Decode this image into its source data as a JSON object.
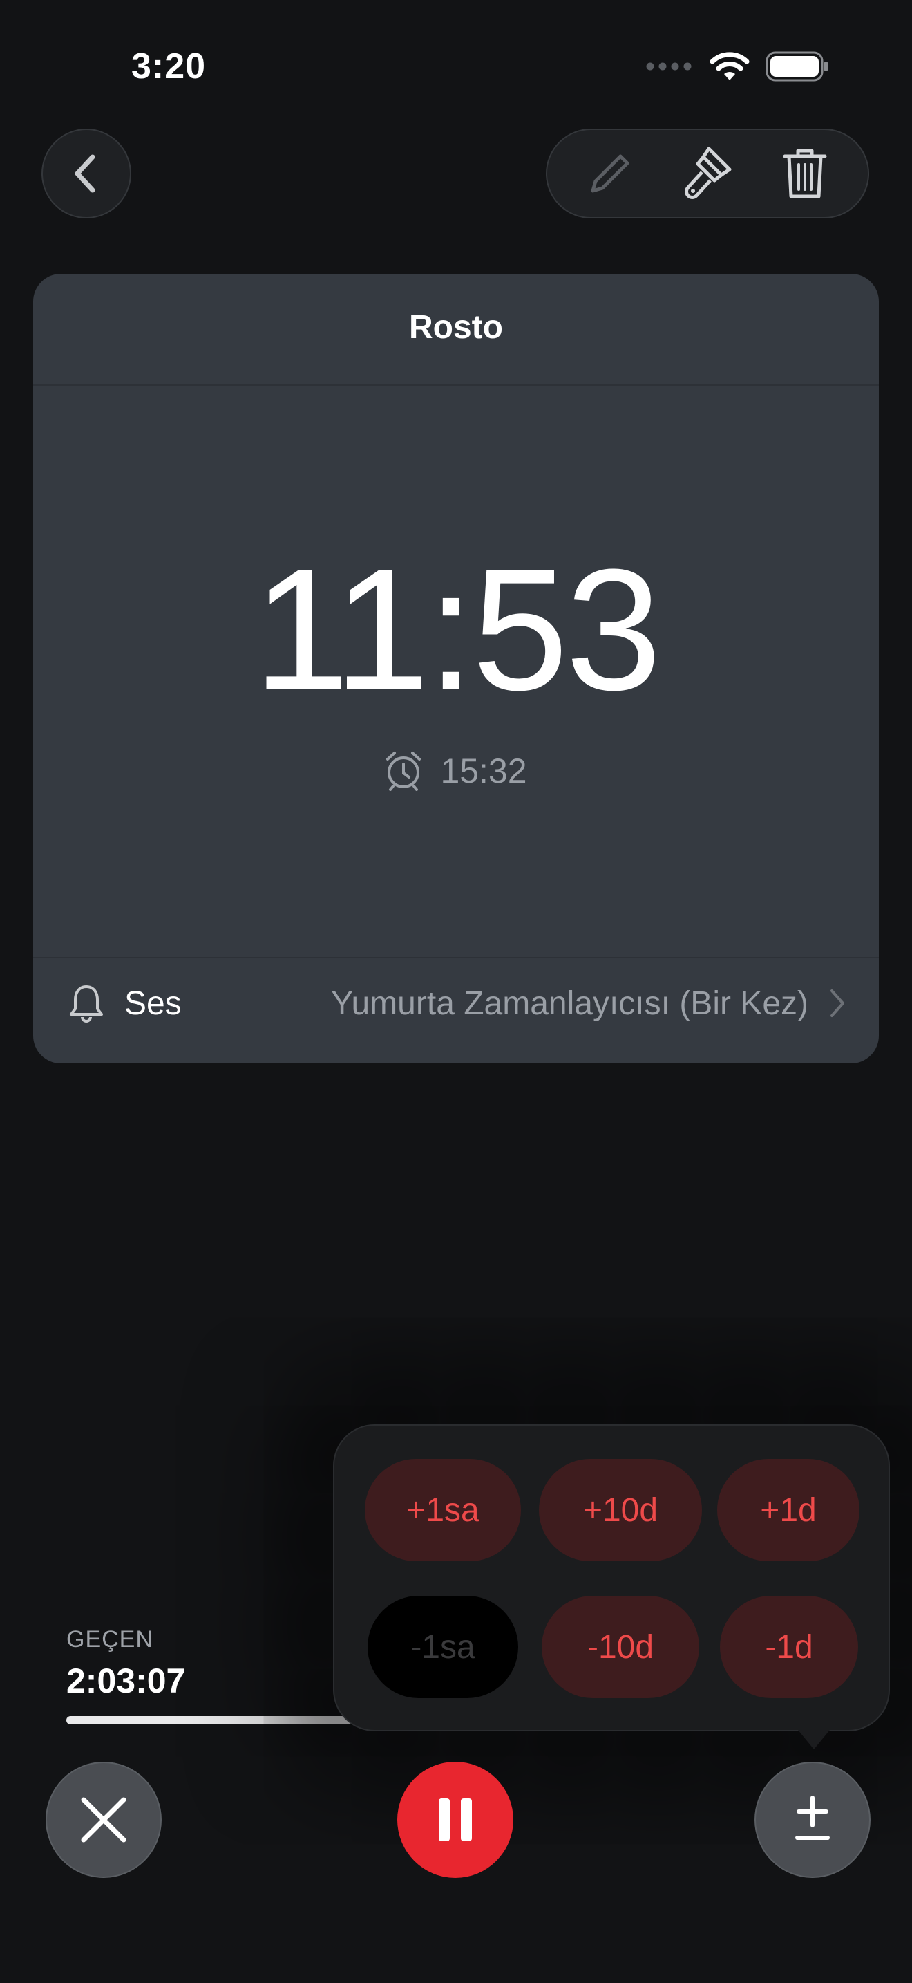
{
  "status_bar": {
    "time": "3:20"
  },
  "toolbar": {
    "back_icon": "chevron-left-icon",
    "edit_icon": "pencil-icon",
    "style_icon": "paintbrush-icon",
    "delete_icon": "trash-icon"
  },
  "timer_card": {
    "title": "Rosto",
    "remaining": "11:53",
    "alarm_time": "15:32",
    "sound_label": "Ses",
    "sound_value": "Yumurta Zamanlayıcısı (Bir Kez)"
  },
  "elapsed": {
    "caption": "GEÇEN",
    "value": "2:03:07",
    "progress_fraction": 0.91
  },
  "adjust_popup": {
    "row1": [
      "+1sa",
      "+10d",
      "+1d"
    ],
    "row2": [
      "-1sa",
      "-10d",
      "-1d"
    ]
  },
  "controls": {
    "cancel_icon": "close-icon",
    "pause_icon": "pause-icon",
    "adjust_icon": "plus-minus-icon"
  },
  "colors": {
    "accent_red": "#e8262f",
    "card_bg": "#353a41",
    "background": "#121315"
  }
}
